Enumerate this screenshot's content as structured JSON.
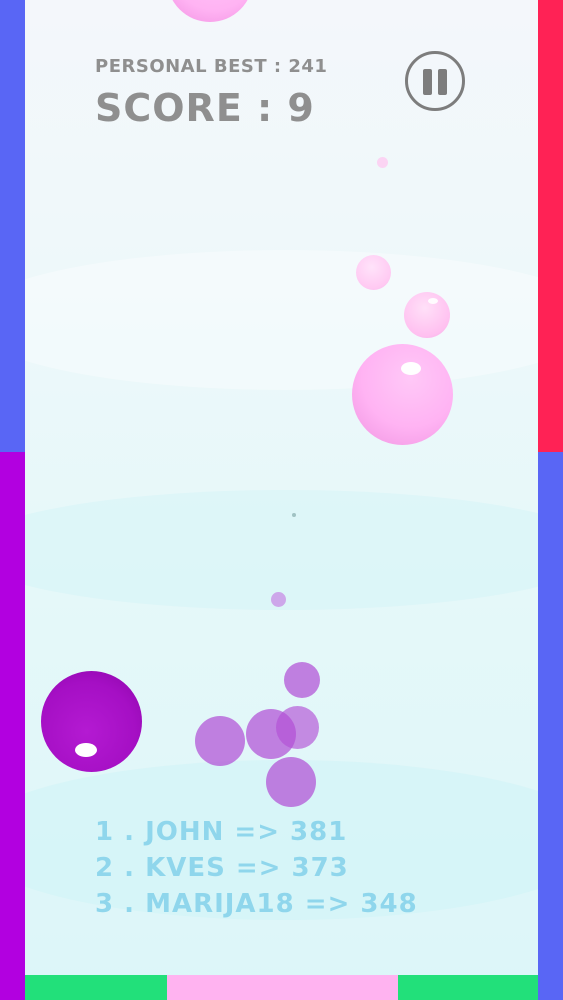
{
  "hud": {
    "personal_best_label": "PERSONAL BEST : 241",
    "score_label": "SCORE : 9"
  },
  "pause_button": {
    "icon": "pause-icon"
  },
  "leaderboard": [
    "1 . JOHN => 381",
    "2 . KVES => 373",
    "3 . MARIJA18 => 348"
  ],
  "colors": {
    "left_wall_top": "#5966f5",
    "left_wall_bottom": "#b200e0",
    "right_wall_top": "#ff2255",
    "right_wall_bottom": "#5966f5",
    "floor_left": "#22e07a",
    "floor_middle": "#ffb3f0",
    "floor_right": "#22e07a",
    "player_ball": "#a50fc4",
    "pink_ball": "#ffb3f3",
    "purple_bubble": "#b350d6"
  }
}
